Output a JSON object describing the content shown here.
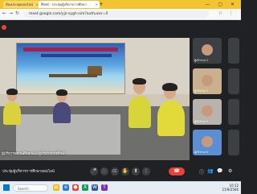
{
  "browser": {
    "tabs": [
      {
        "label": "ห้องประชุมออนไลน์"
      },
      {
        "label": "Meet - ประชุมผู้บริหารการศึกษา"
      }
    ],
    "new_tab": "+",
    "address": "meet.google.com/yjz-vygh-sim?authuser=0"
  },
  "meeting": {
    "caption": "ผู้บริหารสถานศึกษาและผู้บริหารการศึกษา",
    "name": "ประชุมผู้บริหารการศึกษาออนไลน์",
    "participants": [
      {
        "name": "ผู้เข้าร่วม 1"
      },
      {
        "name": "ผู้เข้าร่วม 2"
      },
      {
        "name": "ผู้เข้าร่วม 3"
      },
      {
        "name": "ผู้เข้าร่วม 4"
      }
    ],
    "controls": {
      "mic": "🎤",
      "camera": "🎥",
      "captions": "CC",
      "hand": "✋",
      "present": "⬆",
      "more": "⋮",
      "end": "☎",
      "info": "ⓘ",
      "people": "👥",
      "chat": "💬",
      "activities": "⚙"
    }
  },
  "taskbar": {
    "search_placeholder": "Search",
    "time": "10:12",
    "date": "21/9/2566"
  },
  "colors": {
    "accent": "#f4c430",
    "meet_bg": "#202124",
    "end_call": "#ea4335"
  }
}
